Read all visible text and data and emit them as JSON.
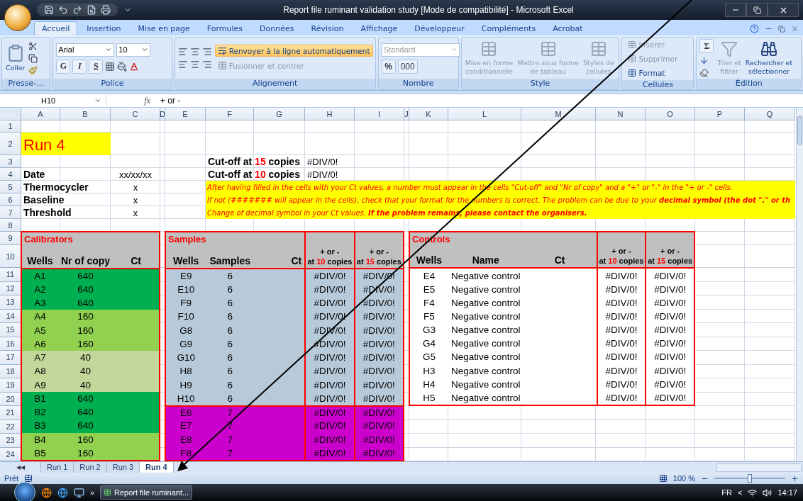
{
  "window": {
    "title": "Report file ruminant validation study  [Mode de compatibilité] - Microsoft Excel"
  },
  "ribbon_tabs": [
    {
      "label": "Accueil",
      "selected": true
    },
    {
      "label": "Insertion",
      "selected": false
    },
    {
      "label": "Mise en page",
      "selected": false
    },
    {
      "label": "Formules",
      "selected": false
    },
    {
      "label": "Données",
      "selected": false
    },
    {
      "label": "Révision",
      "selected": false
    },
    {
      "label": "Affichage",
      "selected": false
    },
    {
      "label": "Développeur",
      "selected": false
    },
    {
      "label": "Compléments",
      "selected": false
    },
    {
      "label": "Acrobat",
      "selected": false
    }
  ],
  "ribbon_groups": [
    {
      "kind": "clipboard",
      "label": "Presse-...",
      "paste": "Coller"
    },
    {
      "kind": "font",
      "label": "Police",
      "font": "Arial",
      "size": "10",
      "bold": "G",
      "italic": "I",
      "underline": "S"
    },
    {
      "kind": "alignment",
      "label": "Alignement",
      "wrap": {
        "label": "Renvoyer à la ligne automatiquement",
        "active": true
      },
      "merge": {
        "label": "Fusionner et centrer",
        "disabled": true
      }
    },
    {
      "kind": "number",
      "label": "Nombre",
      "format": "Standard",
      "percent": "%",
      "thousands": "000"
    },
    {
      "kind": "style",
      "label": "Style",
      "buttons": [
        {
          "lines": [
            "Mise en forme",
            "conditionnelle"
          ],
          "disabled": true
        },
        {
          "lines": [
            "Mettre sous forme",
            "de tableau"
          ],
          "disabled": true
        },
        {
          "lines": [
            "Styles de",
            "cellules"
          ],
          "disabled": true
        }
      ]
    },
    {
      "kind": "cells",
      "label": "Cellules",
      "buttons": [
        {
          "lines": [
            "Insérer"
          ],
          "disabled": true
        },
        {
          "lines": [
            "Supprimer"
          ],
          "disabled": true
        },
        {
          "lines": [
            "Format"
          ],
          "disabled": false
        }
      ]
    },
    {
      "kind": "editing",
      "label": "Édition",
      "sum": "Σ",
      "buttons": [
        {
          "lines": [
            "Trier et",
            "filtrer"
          ],
          "disabled": true
        },
        {
          "lines": [
            "Rechercher et",
            "sélectionner"
          ],
          "disabled": false
        }
      ]
    }
  ],
  "formula_bar": {
    "cell": "H10",
    "fx": "fx",
    "formula": "+ or -"
  },
  "columns": [
    "A",
    "B",
    "C",
    "D",
    "E",
    "F",
    "G",
    "H",
    "I",
    "J",
    "K",
    "L",
    "M",
    "N",
    "O",
    "P",
    "Q"
  ],
  "row_numbers": [
    "1",
    "2",
    "3",
    "4",
    "5",
    "6",
    "7",
    "8",
    "9",
    "10",
    "11",
    "12",
    "13",
    "14",
    "15",
    "16",
    "17",
    "18",
    "19",
    "20",
    "21",
    "22",
    "23",
    "24"
  ],
  "sheet": {
    "title": "Run 4",
    "info": [
      {
        "label": "Date",
        "value": "xx/xx/xx"
      },
      {
        "label": "Thermocycler",
        "value": "x"
      },
      {
        "label": "Baseline",
        "value": "x"
      },
      {
        "label": "Threshold",
        "value": "x"
      }
    ],
    "cutoffs": [
      {
        "prefix": "Cut-off at",
        "number": "15",
        "suffix": "copies",
        "value": "#DIV/0!"
      },
      {
        "prefix": "Cut-off at",
        "number": "10",
        "suffix": "copies",
        "value": "#DIV/0!"
      }
    ],
    "notice": [
      "After having filled in the cells with your Ct values, a number must appear in the cells \"Cut-off\" and \"Nr of copy\" and a \"+\" or \"-\" in the \"+ or -\" cells.",
      "If not (####### will appear in the cells), check that your format for the numbers is correct. The problem can be due to your  **decimal symbol (the dot \".\" or th**",
      "Change of decimal symbol in your Ct values.  **If the problem remains, please contact the organisers.**"
    ],
    "calibrators": {
      "title": "Calibrators",
      "columns": [
        "Wells",
        "Nr of copy",
        "Ct"
      ],
      "rows": [
        {
          "well": "A1",
          "copies": "640",
          "color": "#00b050"
        },
        {
          "well": "A2",
          "copies": "640",
          "color": "#00b050"
        },
        {
          "well": "A3",
          "copies": "640",
          "color": "#00b050"
        },
        {
          "well": "A4",
          "copies": "160",
          "color": "#92d050"
        },
        {
          "well": "A5",
          "copies": "160",
          "color": "#92d050"
        },
        {
          "well": "A6",
          "copies": "160",
          "color": "#92d050"
        },
        {
          "well": "A7",
          "copies": "40",
          "color": "#c4d79b"
        },
        {
          "well": "A8",
          "copies": "40",
          "color": "#c4d79b"
        },
        {
          "well": "A9",
          "copies": "40",
          "color": "#c4d79b"
        },
        {
          "well": "B1",
          "copies": "640",
          "color": "#00b050"
        },
        {
          "well": "B2",
          "copies": "640",
          "color": "#00b050"
        },
        {
          "well": "B3",
          "copies": "640",
          "color": "#00b050"
        },
        {
          "well": "B4",
          "copies": "160",
          "color": "#92d050"
        },
        {
          "well": "B5",
          "copies": "160",
          "color": "#92d050"
        }
      ]
    },
    "samples": {
      "title": "Samples",
      "columns": [
        "Wells",
        "Samples",
        "Ct"
      ],
      "result_columns": [
        {
          "line1": "+ or -",
          "prefix": "at",
          "number": "10",
          "suffix": "copies"
        },
        {
          "line1": "+ or -",
          "prefix": "at",
          "number": "15",
          "suffix": "copies"
        }
      ],
      "rows": [
        {
          "well": "E9",
          "sample": "6",
          "results": [
            "#DIV/0!",
            "#DIV/0!"
          ],
          "color": "#b7cad9"
        },
        {
          "well": "E10",
          "sample": "6",
          "results": [
            "#DIV/0!",
            "#DIV/0!"
          ],
          "color": "#b7cad9"
        },
        {
          "well": "F9",
          "sample": "6",
          "results": [
            "#DIV/0!",
            "#DIV/0!"
          ],
          "color": "#b7cad9"
        },
        {
          "well": "F10",
          "sample": "6",
          "results": [
            "#DIV/0!",
            "#DIV/0!"
          ],
          "color": "#b7cad9"
        },
        {
          "well": "G8",
          "sample": "6",
          "results": [
            "#DIV/0!",
            "#DIV/0!"
          ],
          "color": "#b7cad9"
        },
        {
          "well": "G9",
          "sample": "6",
          "results": [
            "#DIV/0!",
            "#DIV/0!"
          ],
          "color": "#b7cad9"
        },
        {
          "well": "G10",
          "sample": "6",
          "results": [
            "#DIV/0!",
            "#DIV/0!"
          ],
          "color": "#b7cad9"
        },
        {
          "well": "H8",
          "sample": "6",
          "results": [
            "#DIV/0!",
            "#DIV/0!"
          ],
          "color": "#b7cad9"
        },
        {
          "well": "H9",
          "sample": "6",
          "results": [
            "#DIV/0!",
            "#DIV/0!"
          ],
          "color": "#b7cad9"
        },
        {
          "well": "H10",
          "sample": "6",
          "results": [
            "#DIV/0!",
            "#DIV/0!"
          ],
          "color": "#b7cad9"
        },
        {
          "well": "E6",
          "sample": "7",
          "results": [
            "#DIV/0!",
            "#DIV/0!"
          ],
          "color": "#cc00cc"
        },
        {
          "well": "E7",
          "sample": "7",
          "results": [
            "#DIV/0!",
            "#DIV/0!"
          ],
          "color": "#cc00cc"
        },
        {
          "well": "E8",
          "sample": "7",
          "results": [
            "#DIV/0!",
            "#DIV/0!"
          ],
          "color": "#cc00cc"
        },
        {
          "well": "F8",
          "sample": "7",
          "results": [
            "#DIV/0!",
            "#DIV/0!"
          ],
          "color": "#cc00cc"
        }
      ]
    },
    "controls": {
      "title": "Controls",
      "columns": [
        "Wells",
        "Name",
        "Ct"
      ],
      "result_columns": [
        {
          "line1": "+ or -",
          "prefix": "at",
          "number": "10",
          "suffix": "copies"
        },
        {
          "line1": "+ or -",
          "prefix": "at",
          "number": "15",
          "suffix": "copies"
        }
      ],
      "rows": [
        {
          "well": "E4",
          "name": "Negative control",
          "results": [
            "#DIV/0!",
            "#DIV/0!"
          ]
        },
        {
          "well": "E5",
          "name": "Negative control",
          "results": [
            "#DIV/0!",
            "#DIV/0!"
          ]
        },
        {
          "well": "F4",
          "name": "Negative control",
          "results": [
            "#DIV/0!",
            "#DIV/0!"
          ]
        },
        {
          "well": "F5",
          "name": "Negative control",
          "results": [
            "#DIV/0!",
            "#DIV/0!"
          ]
        },
        {
          "well": "G3",
          "name": "Negative control",
          "results": [
            "#DIV/0!",
            "#DIV/0!"
          ]
        },
        {
          "well": "G4",
          "name": "Negative control",
          "results": [
            "#DIV/0!",
            "#DIV/0!"
          ]
        },
        {
          "well": "G5",
          "name": "Negative control",
          "results": [
            "#DIV/0!",
            "#DIV/0!"
          ]
        },
        {
          "well": "H3",
          "name": "Negative control",
          "results": [
            "#DIV/0!",
            "#DIV/0!"
          ]
        },
        {
          "well": "H4",
          "name": "Negative control",
          "results": [
            "#DIV/0!",
            "#DIV/0!"
          ]
        },
        {
          "well": "H5",
          "name": "Negative control",
          "results": [
            "#DIV/0!",
            "#DIV/0!"
          ]
        }
      ]
    }
  },
  "sheet_nav": "◀◀",
  "sheet_tabs": [
    {
      "label": "Run 1",
      "selected": false
    },
    {
      "label": "Run 2",
      "selected": false
    },
    {
      "label": "Run 3",
      "selected": false
    },
    {
      "label": "Run 4",
      "selected": true
    }
  ],
  "status_bar": {
    "status": "Prêt",
    "zoom": "100 %",
    "zoom_slider": {
      "level": 0.5
    }
  },
  "taskbar": {
    "more": "»",
    "task": "Report file ruminant...",
    "language": "FR",
    "tray_toggle": "<",
    "time": "14:17"
  }
}
